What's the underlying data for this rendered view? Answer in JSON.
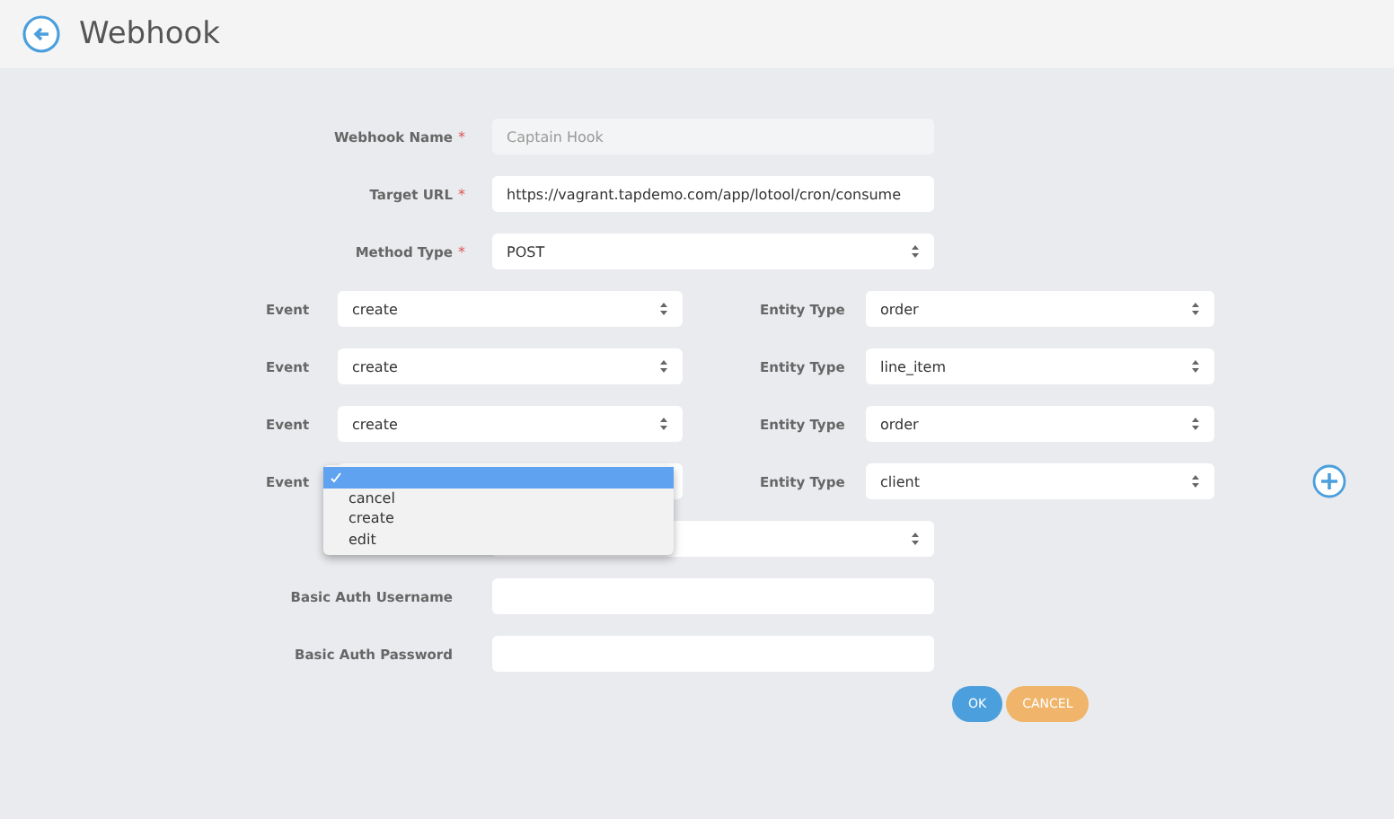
{
  "header": {
    "title": "Webhook"
  },
  "fields": [
    {
      "label": "Webhook Name",
      "required_mark": "*",
      "kind": "input",
      "value": "Captain Hook",
      "disabled": true
    },
    {
      "label": "Target URL",
      "required_mark": "*",
      "kind": "input",
      "value": "https://vagrant.tapdemo.com/app/lotool/cron/consume",
      "disabled": false
    },
    {
      "label": "Method Type",
      "required_mark": "*",
      "kind": "select",
      "value": "POST",
      "disabled": false
    }
  ],
  "events": [
    {
      "event_label": "Event",
      "event": "create",
      "entity_label": "Entity Type",
      "entity": "order"
    },
    {
      "event_label": "Event",
      "event": "create",
      "entity_label": "Entity Type",
      "entity": "line_item"
    },
    {
      "event_label": "Event",
      "event": "create",
      "entity_label": "Entity Type",
      "entity": "order"
    },
    {
      "event_label": "Event",
      "entity_label": "Entity Type",
      "entity": "client"
    }
  ],
  "event_dropdown": {
    "options": [
      {
        "selected": true
      },
      {
        "label": "cancel",
        "selected": false
      },
      {
        "label": "create",
        "selected": false
      },
      {
        "label": "edit",
        "selected": false
      }
    ]
  },
  "auth_fields": [
    {
      "kind": "select"
    },
    {
      "kind": "input",
      "label": "Basic Auth Username"
    },
    {
      "kind": "input",
      "label": "Basic Auth Password"
    }
  ],
  "buttons": [
    {
      "label": "OK",
      "kind": "primary"
    },
    {
      "label": "CANCEL",
      "kind": "secondary"
    }
  ]
}
